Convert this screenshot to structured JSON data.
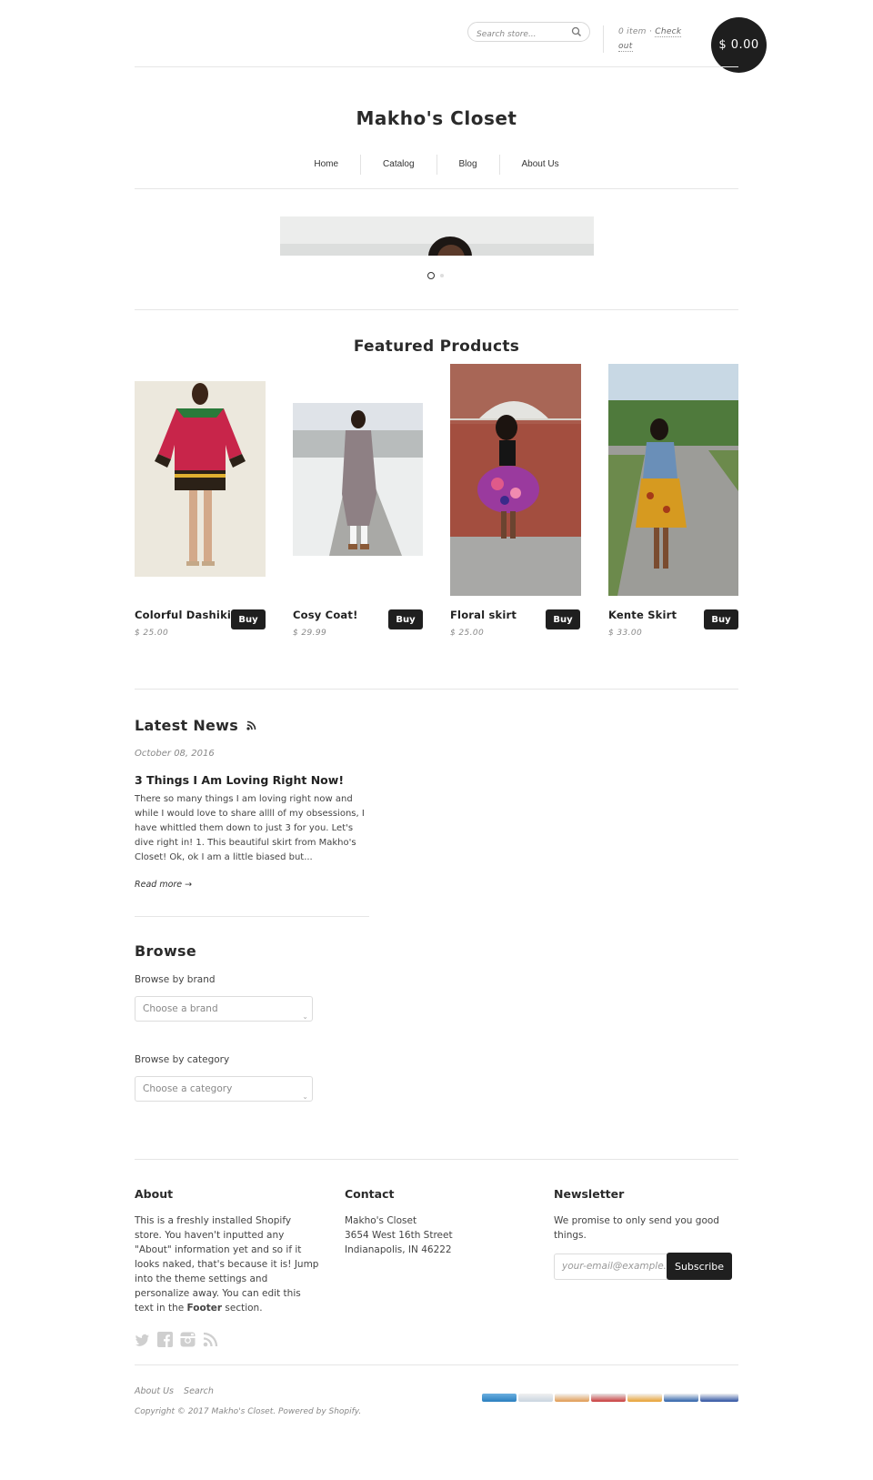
{
  "header": {
    "search_placeholder": "Search store...",
    "cart_count": "0 item",
    "cart_sep": "·",
    "checkout_1": "Check",
    "checkout_2": "out",
    "cart_total": "$ 0.00"
  },
  "site": {
    "title": "Makho's Closet"
  },
  "nav": [
    "Home",
    "Catalog",
    "Blog",
    "About Us"
  ],
  "featured": {
    "title": "Featured Products",
    "products": [
      {
        "name": "Colorful Dashiki",
        "price": "$ 25.00",
        "buy": "Buy"
      },
      {
        "name": "Cosy Coat!",
        "price": "$ 29.99",
        "buy": "Buy"
      },
      {
        "name": "Floral skirt",
        "price": "$ 25.00",
        "buy": "Buy"
      },
      {
        "name": "Kente Skirt",
        "price": "$ 33.00",
        "buy": "Buy"
      }
    ]
  },
  "news": {
    "title": "Latest News",
    "date": "October 08, 2016",
    "post_title": "3 Things I Am Loving Right Now!",
    "excerpt": "There so many things I am loving right now and while I would love to share allll of my obsessions, I have whittled them down to just 3 for you. Let's dive right in!    1. This beautiful skirt from Makho's Closet! Ok, ok I am a little biased but...",
    "read_more": "Read more →"
  },
  "browse": {
    "title": "Browse",
    "brand_label": "Browse by brand",
    "brand_placeholder": "Choose a brand",
    "category_label": "Browse by category",
    "category_placeholder": "Choose a category"
  },
  "footer": {
    "about_title": "About",
    "about_text": "This is a freshly installed Shopify store. You haven't inputted any \"About\" information yet and so if it looks naked, that's because it is! Jump into the theme settings and personalize away. You can edit this text in the",
    "about_bold": "Footer",
    "about_end": " section.",
    "contact_title": "Contact",
    "contact_lines": [
      "Makho's Closet",
      "3654 West 16th Street",
      "Indianapolis, IN 46222"
    ],
    "newsletter_title": "Newsletter",
    "newsletter_text": "We promise to only send you good things.",
    "email_placeholder": "your-email@example.com",
    "subscribe": "Subscribe",
    "links": [
      "About Us",
      "Search"
    ],
    "copyright": "Copyright © 2017 Makho's Closet. Powered by Shopify."
  },
  "colors": {
    "dark": "#1f1f1f",
    "rule": "#e6e6e6",
    "muted": "#888888"
  },
  "icons": [
    "search-icon",
    "rss-icon",
    "twitter-icon",
    "facebook-icon",
    "instagram-icon",
    "rss-feed-icon"
  ]
}
